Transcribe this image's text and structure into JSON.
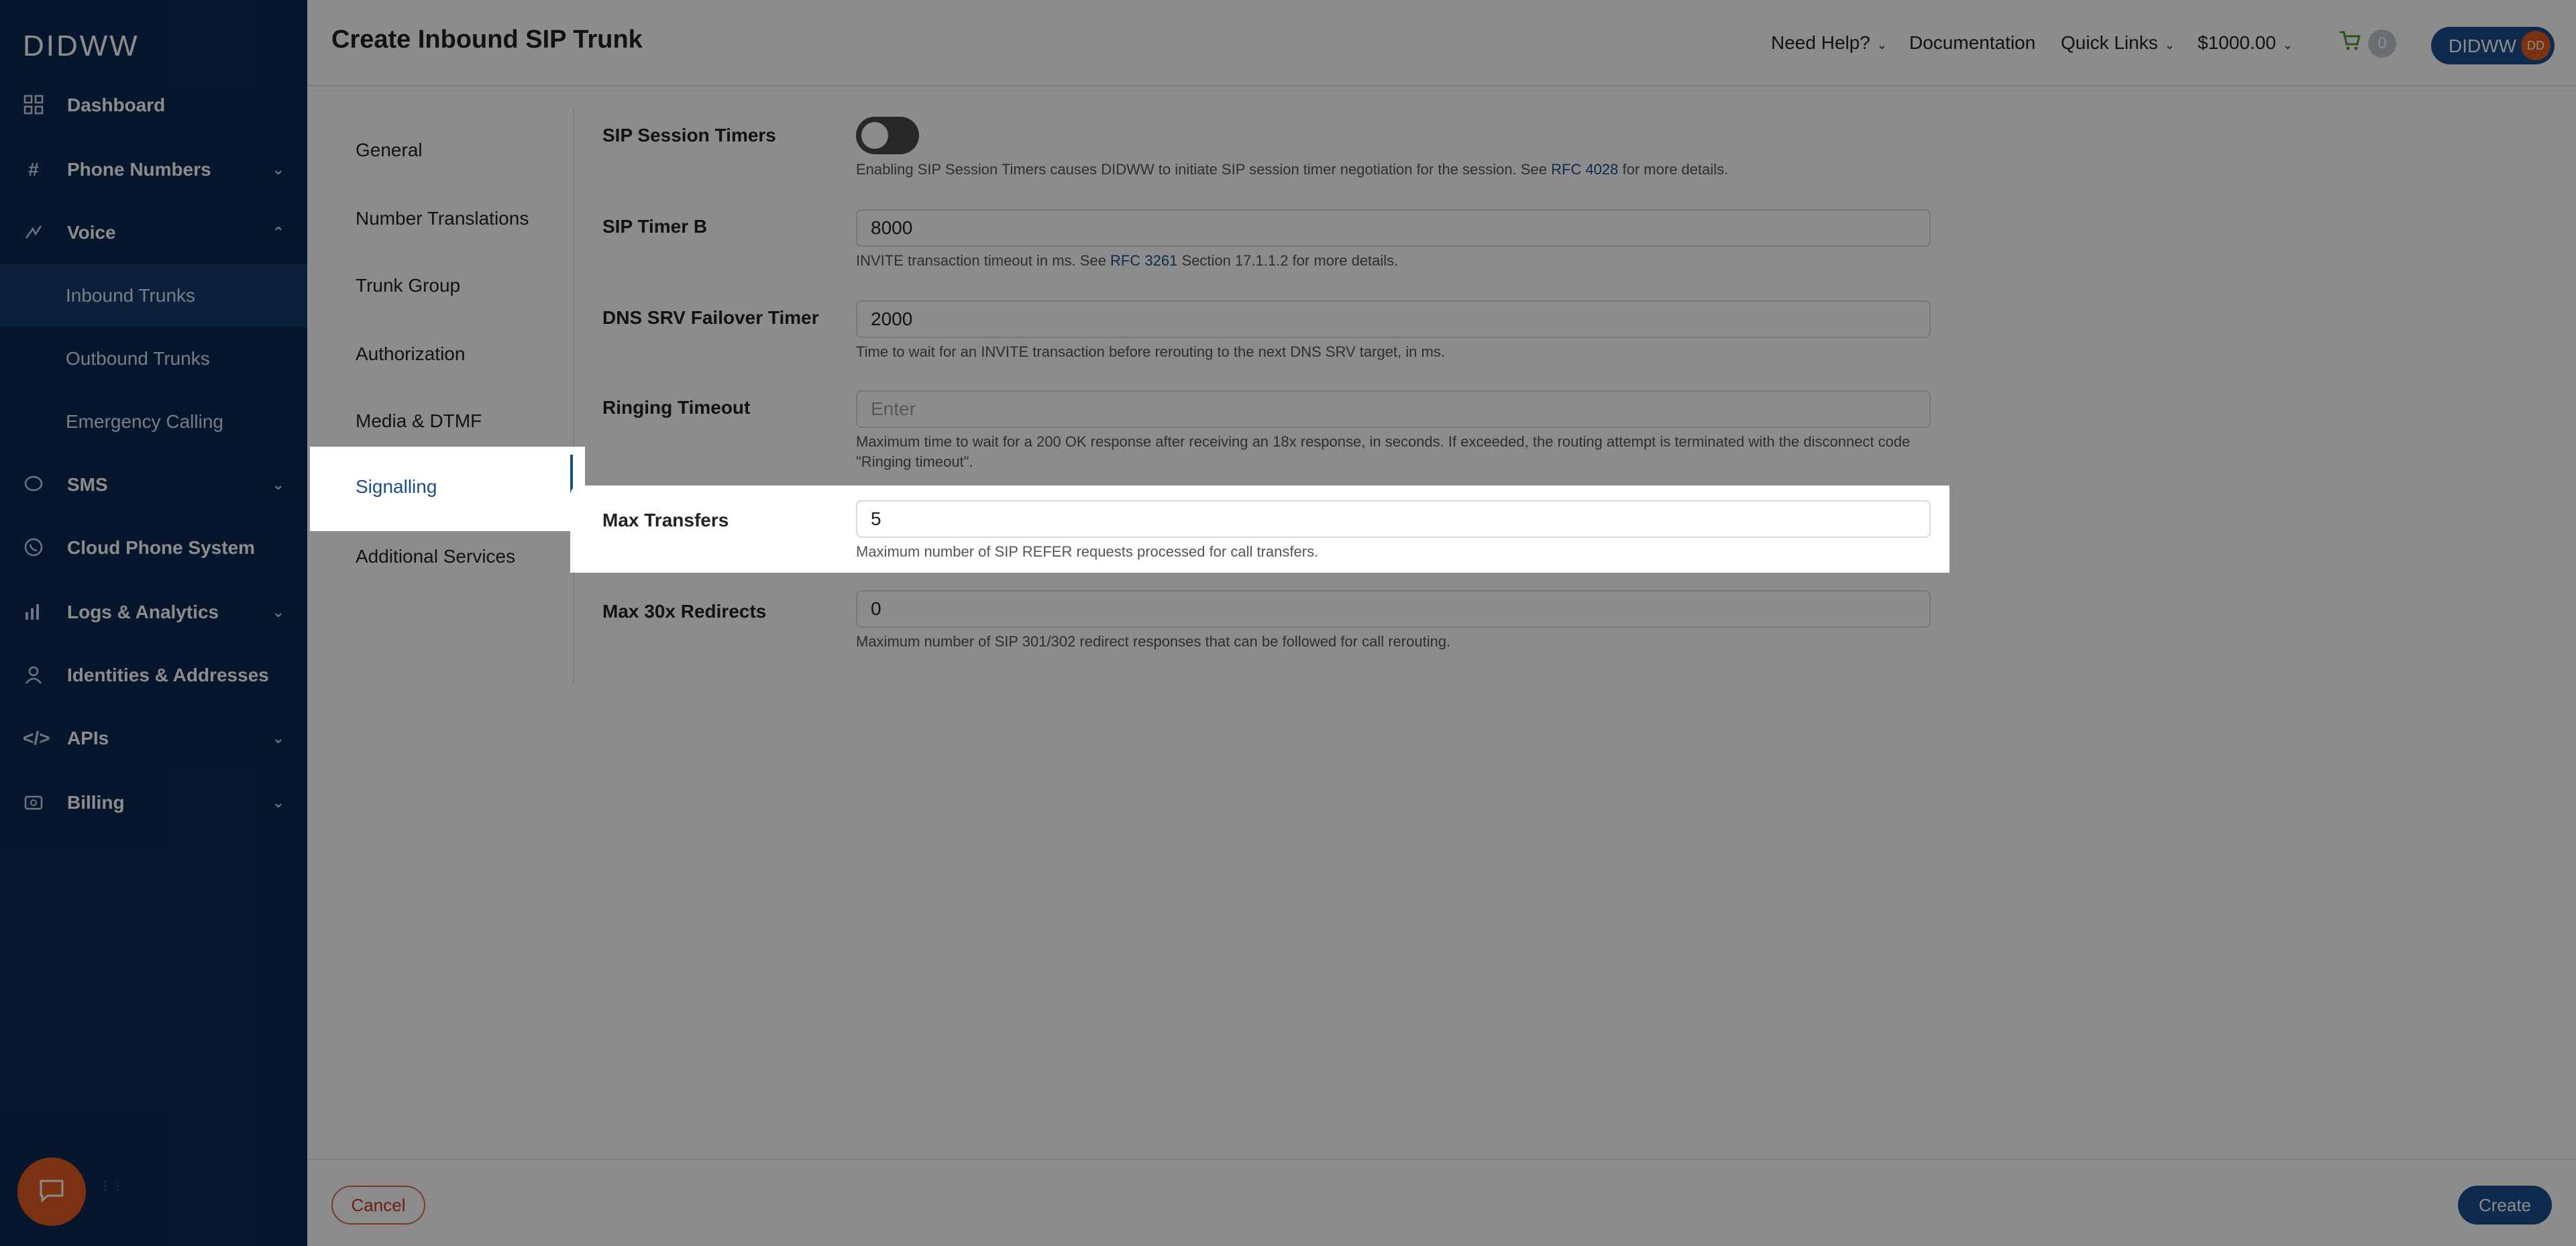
{
  "sidebar": {
    "logo": "DIDWW",
    "items": [
      {
        "label": "Dashboard",
        "icon": "grid-icon"
      },
      {
        "label": "Phone Numbers",
        "icon": "hash-icon"
      },
      {
        "label": "Voice",
        "icon": "voice-icon"
      },
      {
        "label": "SMS",
        "icon": "chat-bubble-icon"
      },
      {
        "label": "Cloud Phone System",
        "icon": "phone-icon"
      },
      {
        "label": "Logs & Analytics",
        "icon": "bar-chart-icon"
      },
      {
        "label": "Identities & Addresses",
        "icon": "user-icon"
      },
      {
        "label": "APIs",
        "icon": "code-icon"
      },
      {
        "label": "Billing",
        "icon": "wallet-icon"
      }
    ],
    "voice_sub": [
      "Inbound Trunks",
      "Outbound Trunks",
      "Emergency Calling"
    ]
  },
  "header": {
    "title": "Create Inbound SIP Trunk",
    "need_help": "Need Help?",
    "documentation": "Documentation",
    "quick_links": "Quick Links",
    "balance": "$1000.00",
    "cart_count": "0",
    "user_name": "DIDWW",
    "user_initials": "DD"
  },
  "subnav": [
    "General",
    "Number Translations",
    "Trunk Group",
    "Authorization",
    "Media & DTMF",
    "Signalling",
    "Additional Services"
  ],
  "form": {
    "sip_session_timers": {
      "label": "SIP Session Timers",
      "enabled": false,
      "help_pre": "Enabling SIP Session Timers causes DIDWW to initiate SIP session timer negotiation for the session. See ",
      "help_link": "RFC 4028",
      "help_post": " for more details."
    },
    "sip_timer_b": {
      "label": "SIP Timer B",
      "value": "8000",
      "help_pre": "INVITE transaction timeout in ms. See ",
      "help_link": "RFC 3261",
      "help_post": " Section 17.1.1.2 for more details."
    },
    "dns_srv": {
      "label": "DNS SRV Failover Timer",
      "value": "2000",
      "help": "Time to wait for an INVITE transaction before rerouting to the next DNS SRV target, in ms."
    },
    "ringing_timeout": {
      "label": "Ringing Timeout",
      "placeholder": "Enter",
      "help": "Maximum time to wait for a 200 OK response after receiving an 18x response, in seconds. If exceeded, the routing attempt is terminated with the disconnect code \"Ringing timeout\"."
    },
    "max_transfers": {
      "label": "Max Transfers",
      "value": "5",
      "help": "Maximum number of SIP REFER requests processed for call transfers."
    },
    "max_redirects": {
      "label": "Max 30x Redirects",
      "value": "0",
      "help": "Maximum number of SIP 301/302 redirect responses that can be followed for call rerouting."
    }
  },
  "footer": {
    "cancel": "Cancel",
    "create": "Create"
  }
}
